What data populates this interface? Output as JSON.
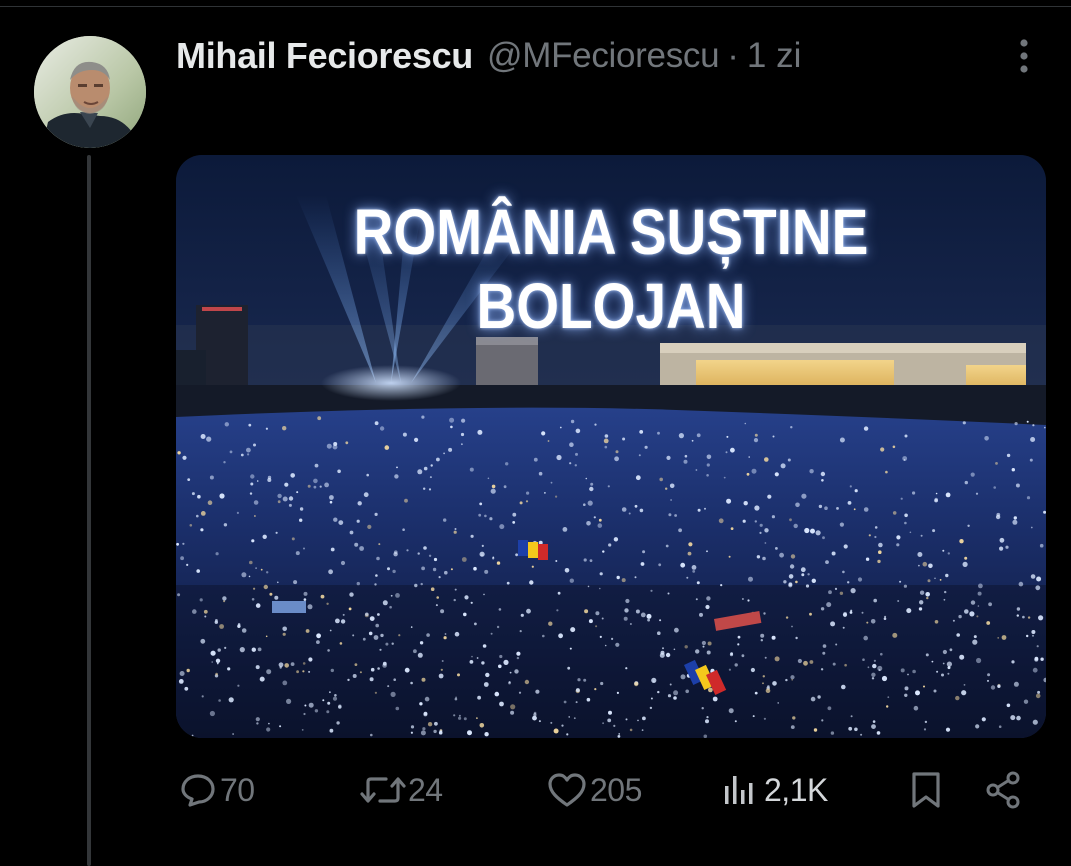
{
  "tweet": {
    "display_name": "Mihail Feciorescu",
    "handle": "@MFeciorescu",
    "separator": "·",
    "time": "1 zi",
    "image_text": "ROMÂNIA SUȘTINE BOLOJAN"
  },
  "actions": {
    "replies": "70",
    "reposts": "24",
    "likes": "205",
    "views": "2,1K"
  },
  "icons": {
    "more": "more-vertical-icon",
    "reply": "speech-bubble-icon",
    "repost": "repost-arrows-icon",
    "like": "heart-icon",
    "views": "bar-chart-icon",
    "bookmark": "bookmark-icon",
    "share": "share-icon"
  },
  "colors": {
    "background": "#000000",
    "text": "#e7e9ea",
    "muted": "#71767b",
    "thread_line": "#333639"
  }
}
